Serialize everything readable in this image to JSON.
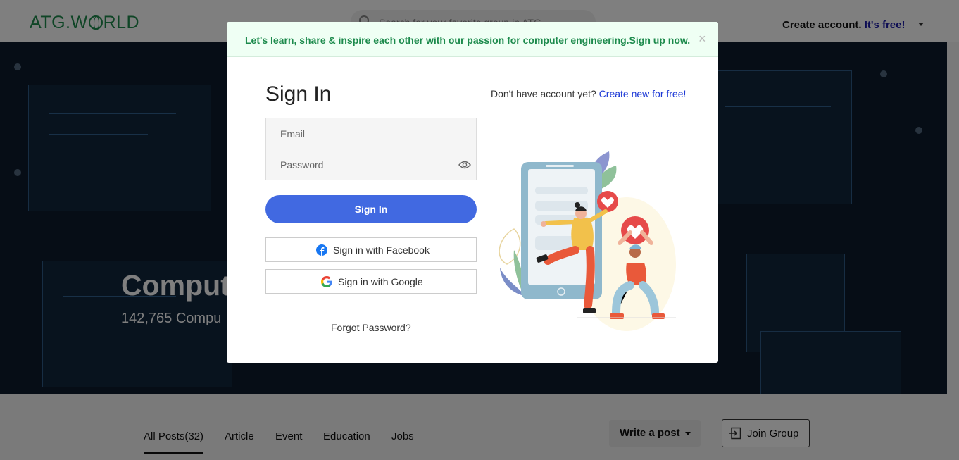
{
  "header": {
    "logo_text": "ATG.WORLD",
    "logo_prefix": "ATG.W",
    "logo_suffix": "RLD",
    "search_placeholder": "Search for your favorite group in ATG",
    "create_account": "Create account.",
    "create_free": "It's free!"
  },
  "hero": {
    "title": "Comput",
    "subtitle": "142,765 Compu"
  },
  "tabs": [
    {
      "label": "All Posts(32)",
      "active": true
    },
    {
      "label": "Article"
    },
    {
      "label": "Event"
    },
    {
      "label": "Education"
    },
    {
      "label": "Jobs"
    }
  ],
  "actions": {
    "write_post": "Write a post",
    "join_group": "Join Group"
  },
  "modal": {
    "banner": "Let's learn, share & inspire each other with our passion for computer engineering.Sign up now.",
    "close": "×",
    "title": "Sign In",
    "no_account": "Don't have account yet?",
    "create_new": "Create new for free!",
    "email_placeholder": "Email",
    "password_placeholder": "Password",
    "sign_in": "Sign In",
    "facebook": "Sign in with Facebook",
    "google": "Sign in with Google",
    "forgot": "Forgot Password?"
  },
  "colors": {
    "brand_green": "#1f8a4c",
    "primary_button": "#4169e1",
    "link_blue": "#1d39d6",
    "banner_bg": "#effff4"
  },
  "icons": [
    "search-icon",
    "chevron-down-icon",
    "close-icon",
    "eye-icon",
    "facebook-icon",
    "google-icon",
    "join-icon"
  ]
}
